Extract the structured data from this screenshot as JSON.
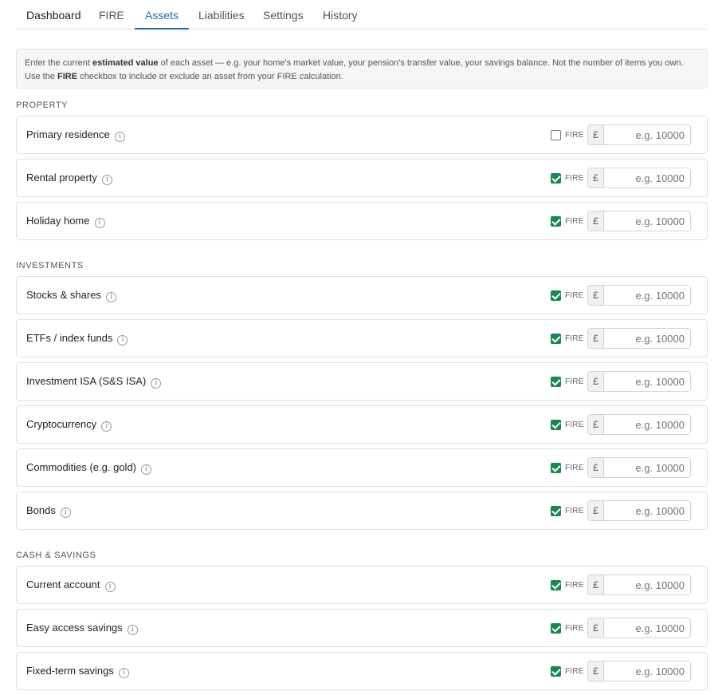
{
  "tabs": [
    {
      "label": "Dashboard"
    },
    {
      "label": "FIRE"
    },
    {
      "label": "Assets"
    },
    {
      "label": "Liabilities"
    },
    {
      "label": "Settings"
    },
    {
      "label": "History"
    }
  ],
  "active_tab": "Assets",
  "info": {
    "t1": "Enter the current ",
    "b1": "estimated value",
    "t2": " of each asset — e.g. your home's market value, your pension's transfer value, your savings balance. Not the number of items you own. Use the ",
    "b2": "FIRE",
    "t3": " checkbox to include or exclude an asset from your FIRE calculation."
  },
  "fire_label": "FIRE",
  "currency_symbol": "£",
  "input_placeholder": "e.g. 10000",
  "info_icon_glyph": "i",
  "colors": {
    "accent": "#1f6fae",
    "checkbox_checked": "#198754"
  },
  "sections": [
    {
      "title": "PROPERTY",
      "items": [
        {
          "label": "Primary residence",
          "fire": false,
          "value": ""
        },
        {
          "label": "Rental property",
          "fire": true,
          "value": ""
        },
        {
          "label": "Holiday home",
          "fire": true,
          "value": ""
        }
      ]
    },
    {
      "title": "INVESTMENTS",
      "items": [
        {
          "label": "Stocks & shares",
          "fire": true,
          "value": ""
        },
        {
          "label": "ETFs / index funds",
          "fire": true,
          "value": ""
        },
        {
          "label": "Investment ISA (S&S ISA)",
          "fire": true,
          "value": ""
        },
        {
          "label": "Cryptocurrency",
          "fire": true,
          "value": ""
        },
        {
          "label": "Commodities (e.g. gold)",
          "fire": true,
          "value": ""
        },
        {
          "label": "Bonds",
          "fire": true,
          "value": ""
        }
      ]
    },
    {
      "title": "CASH & SAVINGS",
      "items": [
        {
          "label": "Current account",
          "fire": true,
          "value": ""
        },
        {
          "label": "Easy access savings",
          "fire": true,
          "value": ""
        },
        {
          "label": "Fixed-term savings",
          "fire": true,
          "value": ""
        }
      ]
    }
  ]
}
